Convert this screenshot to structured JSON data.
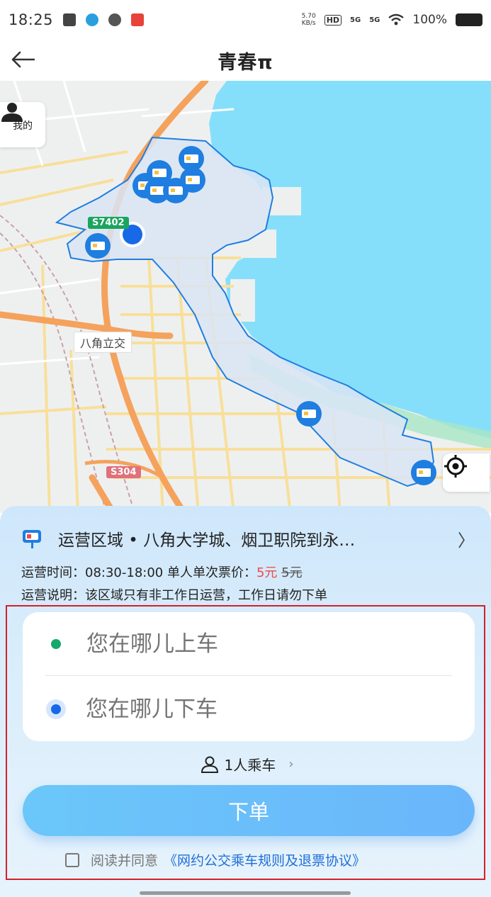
{
  "status_bar": {
    "time": "18:25",
    "net_speed_value": "5.70",
    "net_speed_unit": "KB/s",
    "hd": "HD",
    "signal1": "5G",
    "signal2": "5G",
    "battery": "100%",
    "icons": [
      "message-icon",
      "telegram-icon",
      "wechat-icon",
      "app-icon",
      "wifi-icon",
      "battery-icon"
    ]
  },
  "header": {
    "title": "青春π",
    "back_icon": "arrow-left-icon"
  },
  "map": {
    "me_label": "我的",
    "road_labels": [
      "S7402",
      "S304"
    ],
    "place_label": "八角立交",
    "colors": {
      "sea": "#86dffa",
      "zone_fill": "#dce7f6",
      "zone_border": "#1f7ee0",
      "main_road": "#f5a25c"
    }
  },
  "panel": {
    "area_label": "运营区域 • 八角大学城、烟卫职院到永…",
    "time_line": "运营时间：08:30-18:00   单人单次票价：",
    "price_now": "5元",
    "price_old": "5元",
    "desc_line": "运营说明：该区域只有非工作日运营，工作日请勿下单",
    "pickup_placeholder": "您在哪儿上车",
    "dropoff_placeholder": "您在哪儿下车",
    "passenger_count": "1人乘车",
    "submit_label": "下单",
    "agree_text": "阅读并同意",
    "agreement_link": "《网约公交乘车规则及退票协议》",
    "colors": {
      "price": "#f04a4a",
      "link": "#1f6fd6",
      "pickup_dot": "#14a96a",
      "dropoff_dot": "#1769e8"
    }
  }
}
